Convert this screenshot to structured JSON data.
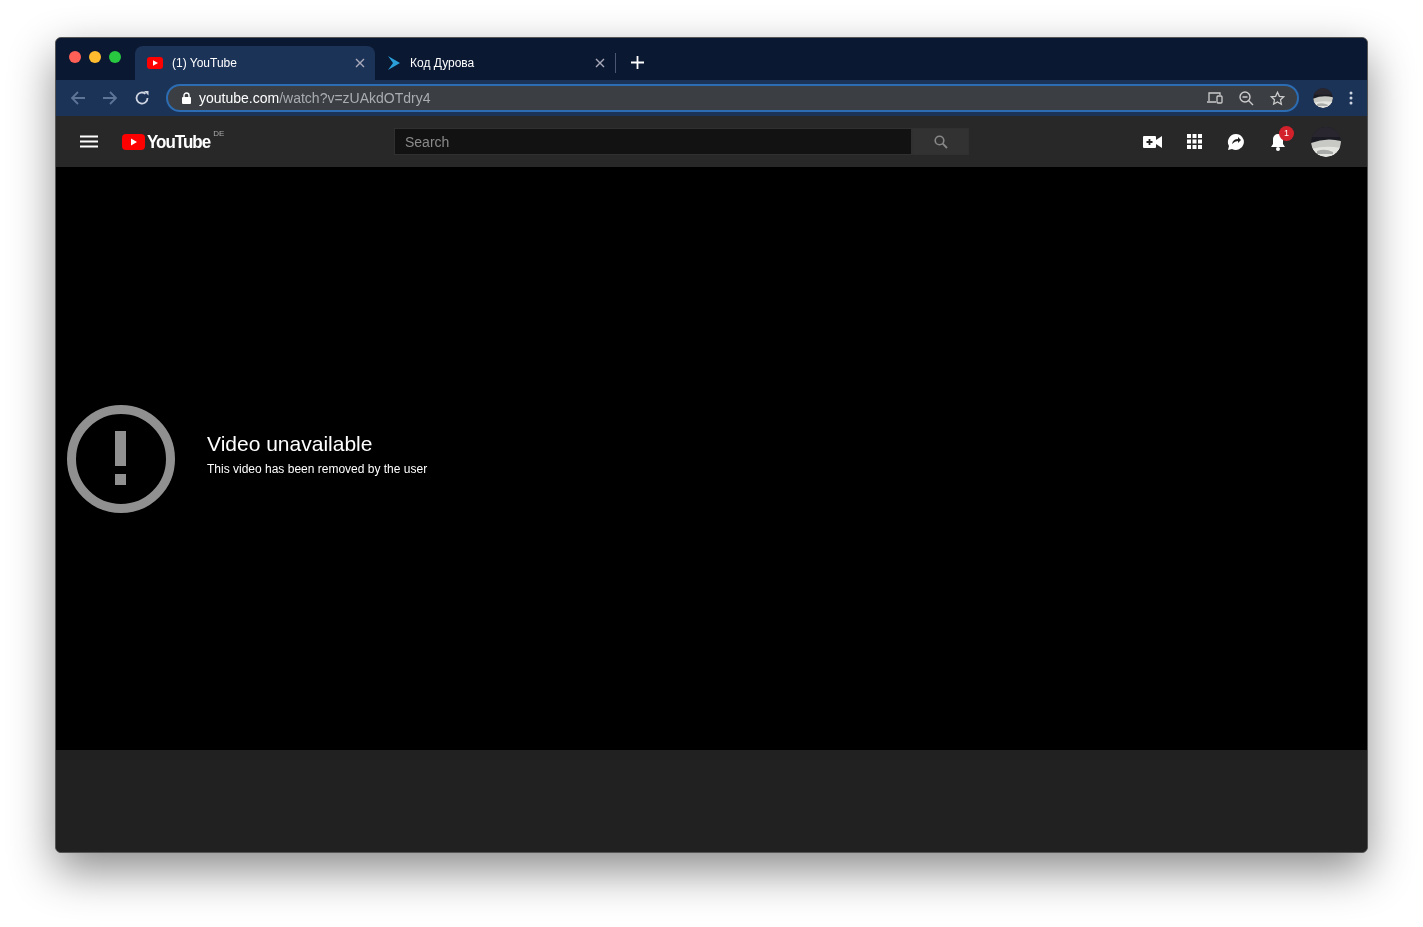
{
  "tabs": [
    {
      "title": "(1) YouTube",
      "kind": "youtube",
      "selected": true
    },
    {
      "title": "Код Дурова",
      "kind": "chevron",
      "selected": false
    }
  ],
  "address_bar": {
    "host": "youtube.com",
    "path": "/watch?v=zUAkdOTdry4"
  },
  "header": {
    "logo": "YouTube",
    "region": "DE",
    "search": {
      "placeholder": "Search"
    },
    "notification_count": "1"
  },
  "player": {
    "title": "Video unavailable",
    "message": "This video has been removed by the user"
  }
}
